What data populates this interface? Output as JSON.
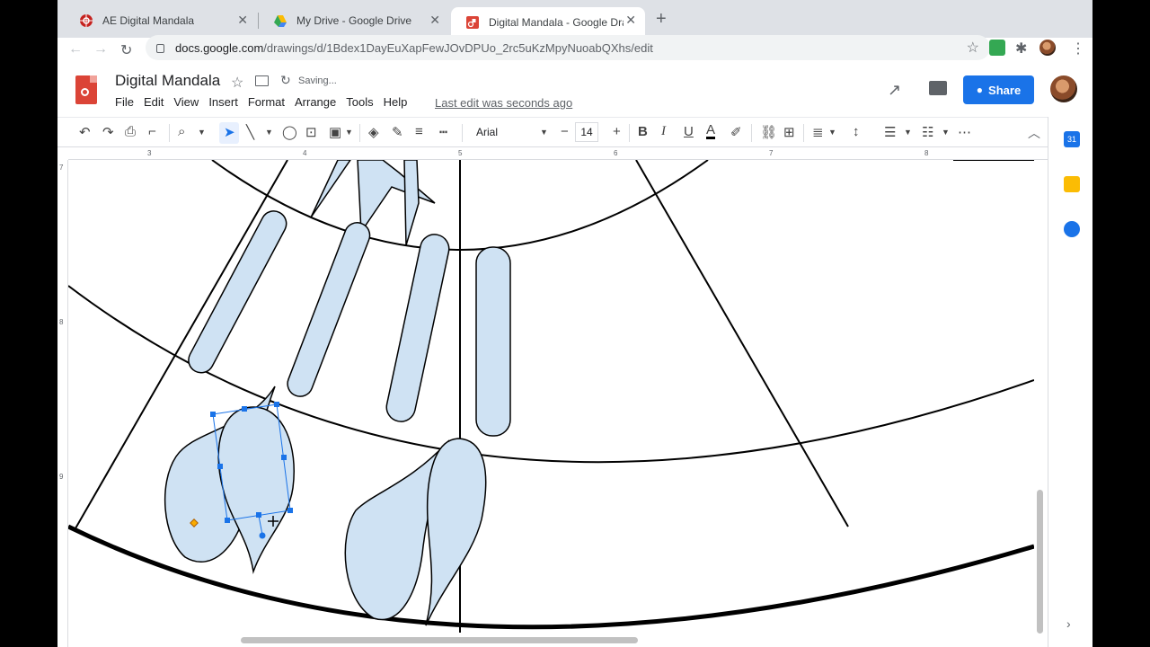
{
  "tabs": [
    {
      "title": "AE Digital Mandala",
      "active": false
    },
    {
      "title": "My Drive - Google Drive",
      "active": false
    },
    {
      "title": "Digital Mandala - Google Drawi",
      "active": true
    }
  ],
  "address": {
    "domain": "docs.google.com",
    "path": "/drawings/d/1Bdex1DayEuXapFewJOvDPUo_2rc5uKzMpyNuoabQXhs/edit"
  },
  "doc": {
    "title": "Digital Mandala",
    "status": "Saving...",
    "last_edit": "Last edit was seconds ago"
  },
  "menu": [
    "File",
    "Edit",
    "View",
    "Insert",
    "Format",
    "Arrange",
    "Tools",
    "Help"
  ],
  "share_label": "Share",
  "toolbar": {
    "font": "Arial",
    "font_size": "14"
  },
  "ruler": {
    "horizontal": [
      "3",
      "4",
      "5",
      "6",
      "7",
      "8"
    ],
    "vertical": [
      "7",
      "8",
      "9"
    ]
  },
  "side_panel": {
    "calendar_label": "31"
  },
  "colors": {
    "accent": "#1a73e8",
    "shape_fill": "#cfe2f3",
    "selection": "#1a73e8",
    "app_red": "#db4437"
  }
}
